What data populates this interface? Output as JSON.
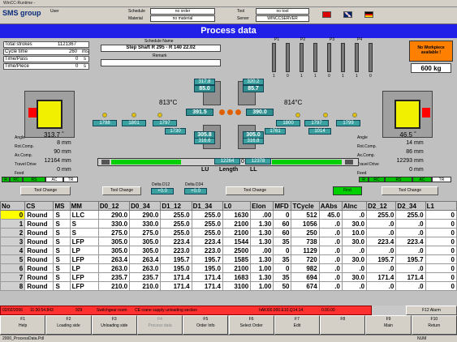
{
  "window": {
    "title": "WinCC-Runtime -"
  },
  "header": {
    "logo": "SMS group",
    "user_label": "User",
    "schedule_label": "Schedule",
    "schedule_value": "no order",
    "material_label": "Material",
    "material_value": "no material",
    "tool_label": "Tool",
    "tool_value": "no tool",
    "server_label": "Server",
    "server_value": "WINCCSERVER"
  },
  "banner": "Process data",
  "stats": [
    {
      "label": "Total strokes",
      "value": "1121367",
      "unit": ""
    },
    {
      "label": "Cycle time",
      "value": "260",
      "unit": "ms"
    },
    {
      "label": "Time/Pass",
      "value": "0",
      "unit": "s"
    },
    {
      "label": "Time/Piece",
      "value": "0",
      "unit": "s"
    }
  ],
  "schedule": {
    "name_label": "Schedule Name",
    "name_value": "Step Shaft R 295 - R 140 22.02",
    "remark_label": "Remark",
    "remark_value": ""
  },
  "p_labels": [
    "P1",
    "P2",
    "P3",
    "P4"
  ],
  "p_ticks": [
    "1",
    "0",
    "1",
    "1",
    "0",
    "1",
    "1",
    "0"
  ],
  "workpiece": {
    "label": "No Workpiece available !",
    "weight": "600",
    "unit": "kg"
  },
  "left": {
    "angle": "313.7",
    "angle_unit": "°",
    "rot": "8",
    "rot_unit": "mm",
    "ax": "90",
    "ax_unit": "mm",
    "travel": "12164",
    "travel_unit": "mm",
    "feed": "0",
    "feed_unit": "mm"
  },
  "right": {
    "angle": "46.5",
    "angle_unit": "°",
    "rot": "14",
    "rot_unit": "mm",
    "ax": "86",
    "ax_unit": "mm",
    "travel": "12293",
    "travel_unit": "mm",
    "feed": "0",
    "feed_unit": "mm"
  },
  "side_labels": [
    "Angle",
    "Rot.Comp.",
    "Ax.Comp.",
    "Travel Drive",
    "Feed"
  ],
  "temps": {
    "left": "813",
    "right": "814",
    "unit": "°C"
  },
  "forge": {
    "tl1": "317.8",
    "tl2": "85.0",
    "tr1": "320.2",
    "tr2": "85.7",
    "ml": "391.5",
    "mr": "390.0",
    "bl1": "305.8",
    "bl2": "316.6",
    "br1": "305.0",
    "br2": "316.8"
  },
  "chain_left": [
    "1798",
    "1801",
    "1797",
    "1730"
  ],
  "chain_right": [
    "1761",
    "1800",
    "1797",
    "1799",
    "1014"
  ],
  "length": {
    "left": "12264",
    "mid": "0",
    "right": "12378",
    "lu": "LU",
    "label": "Length",
    "ll": "LL"
  },
  "indicators": {
    "left": [
      "R",
      "RC",
      "RS",
      "AC",
      "TR"
    ],
    "right": [
      "R",
      "RC",
      "RS",
      "AC",
      "TR"
    ]
  },
  "delta": {
    "d12_label": "Delta D12",
    "d12_value": "+0.0",
    "d34_label": "Delta D34",
    "d34_value": "+0.0"
  },
  "buttons": {
    "tool_change_1": "Tool Change",
    "tool_change_2": "Tool Change",
    "tool_change_3": "Tool Change",
    "tool_change_4": "Tool Change",
    "first": "First"
  },
  "table": {
    "headers": [
      "No",
      "CS",
      "MS",
      "MM",
      "D0_12",
      "D0_34",
      "D1_12",
      "D1_34",
      "L0",
      "Elon",
      "MFD",
      "TCycle",
      "AAbs",
      "AInc",
      "D2_12",
      "D2_34",
      "L1"
    ],
    "rows": [
      [
        "0",
        "Round",
        "S",
        "LLC",
        "290.0",
        "290.0",
        "255.0",
        "255.0",
        "1630",
        ".00",
        "0",
        "512",
        "45.0",
        ".0",
        "255.0",
        "255.0",
        "0"
      ],
      [
        "1",
        "Round",
        "S",
        "S",
        "330.0",
        "330.0",
        "255.0",
        "255.0",
        "2100",
        "1.30",
        "60",
        "1056",
        ".0",
        "30.0",
        ".0",
        ".0",
        "0"
      ],
      [
        "2",
        "Round",
        "S",
        "S",
        "275.0",
        "275.0",
        "255.0",
        "255.0",
        "2100",
        "1.30",
        "60",
        "250",
        ".0",
        "10.0",
        ".0",
        ".0",
        "0"
      ],
      [
        "3",
        "Round",
        "S",
        "LFP",
        "305.0",
        "305.0",
        "223.4",
        "223.4",
        "1544",
        "1.30",
        "35",
        "738",
        ".0",
        "30.0",
        "223.4",
        "223.4",
        "0"
      ],
      [
        "4",
        "Round",
        "S",
        "LP",
        "305.0",
        "305.0",
        "223.0",
        "223.0",
        "2500",
        ".00",
        "0",
        "1129",
        ".0",
        ".0",
        ".0",
        ".0",
        "0"
      ],
      [
        "5",
        "Round",
        "S",
        "LFP",
        "263.4",
        "263.4",
        "195.7",
        "195.7",
        "1585",
        "1.30",
        "35",
        "720",
        ".0",
        "30.0",
        "195.7",
        "195.7",
        "0"
      ],
      [
        "6",
        "Round",
        "S",
        "LP",
        "263.0",
        "263.0",
        "195.0",
        "195.0",
        "2100",
        "1.00",
        "0",
        "982",
        ".0",
        ".0",
        ".0",
        ".0",
        "0"
      ],
      [
        "7",
        "Round",
        "S",
        "LFP",
        "235.7",
        "235.7",
        "171.4",
        "171.4",
        "1683",
        "1.30",
        "35",
        "694",
        ".0",
        "30.0",
        "171.4",
        "171.4",
        "0"
      ],
      [
        "8",
        "Round",
        "S",
        "LFP",
        "210.0",
        "210.0",
        "171.4",
        "171.4",
        "3100",
        "1.00",
        "50",
        "674",
        ".0",
        ".0",
        ".0",
        ".0",
        "0"
      ]
    ]
  },
  "status": {
    "date": "02/02/2006",
    "time": "11:30:54.843",
    "code": "929",
    "msg1": "Switchgear room",
    "msg2": "CE crane supply unloading section",
    "msg3": "hAKI00.000.E10.Q14.14",
    "msg4": "0.00.00",
    "alarm": "F12 Alarm"
  },
  "fkeys": [
    {
      "k": "F1",
      "l": "Help"
    },
    {
      "k": "F2",
      "l": "Loading side"
    },
    {
      "k": "F3",
      "l": "Unloading side"
    },
    {
      "k": "F4",
      "l": "Process data"
    },
    {
      "k": "F5",
      "l": "Order Info"
    },
    {
      "k": "F6",
      "l": "Select Order"
    },
    {
      "k": "F7",
      "l": "Edit"
    },
    {
      "k": "F8",
      "l": ""
    },
    {
      "k": "F9",
      "l": "Main"
    },
    {
      "k": "F10",
      "l": "Return"
    }
  ],
  "footer": {
    "file": "2000_ProcessData.Pdl",
    "num": "NUM"
  }
}
